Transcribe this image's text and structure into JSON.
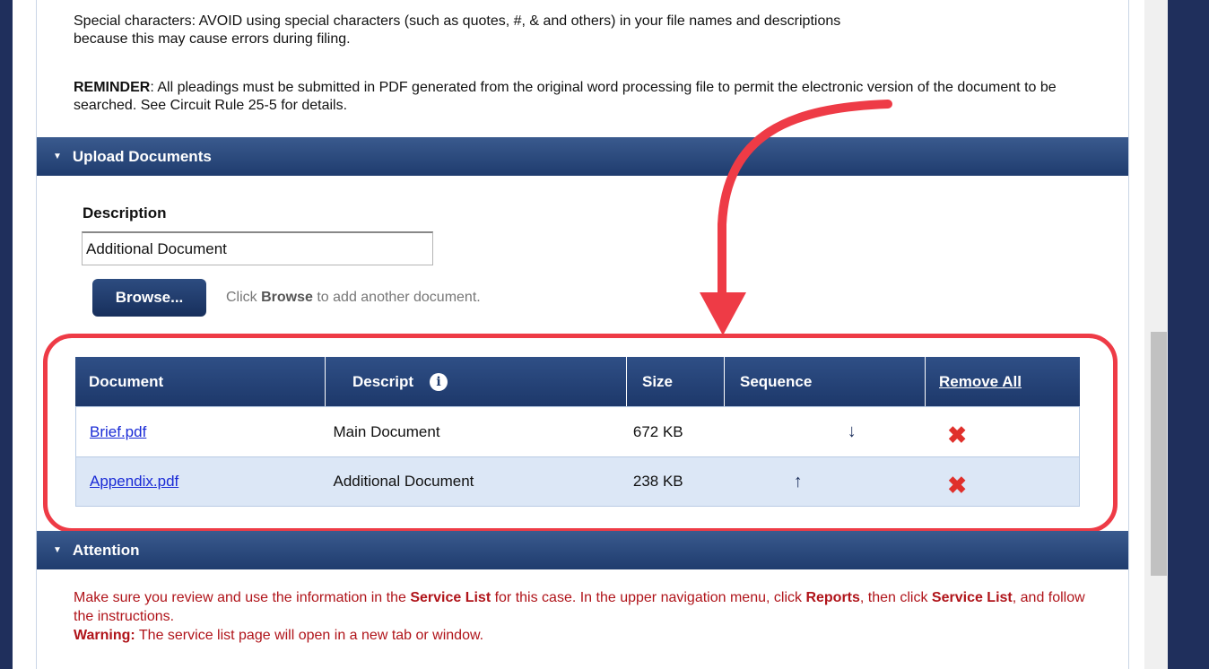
{
  "intro": {
    "special_chars_line1": "Special characters: AVOID using special characters (such as quotes, #, & and others) in your file names and descriptions",
    "special_chars_line2": "because this may cause errors during filing.",
    "reminder_label": "REMINDER",
    "reminder_text": ": All pleadings must be submitted in PDF generated from the original word processing file to permit the electronic version of the document to be searched. See Circuit Rule 25-5 for details."
  },
  "upload_section": {
    "title": "Upload Documents",
    "description_label": "Description",
    "description_value": "Additional Document",
    "browse_label": "Browse...",
    "hint_prefix": "Click ",
    "hint_bold": "Browse",
    "hint_suffix": " to add another document."
  },
  "table": {
    "headers": {
      "document": "Document",
      "description": "Descript",
      "size": "Size",
      "sequence": "Sequence",
      "remove_all": "Remove All"
    },
    "rows": [
      {
        "document": "Brief.pdf",
        "description": "Main Document",
        "size": "672 KB",
        "sequence": "down"
      },
      {
        "document": "Appendix.pdf",
        "description": "Additional Document",
        "size": "238 KB",
        "sequence": "up"
      }
    ]
  },
  "attention_section": {
    "title": "Attention",
    "line1_a": "Make sure you review and use the information in the ",
    "line1_b": "Service List",
    "line1_c": " for this case. In the upper navigation menu, click ",
    "line1_d": "Reports",
    "line1_e": ", then click ",
    "line1_f": "Service List",
    "line1_g": ", and follow the instructions.",
    "warning_label": "Warning:",
    "warning_text": " The service list page will open in a new tab or window."
  },
  "colors": {
    "header_blue": "#1f3c6e",
    "callout_red": "#ee3b46",
    "link_blue": "#1a2bd6",
    "attention_red": "#b0141a",
    "remove_red": "#e0302b"
  },
  "icons": {
    "info": "info-icon",
    "caret": "caret-down-icon",
    "arrow_up": "arrow-up-icon",
    "arrow_down": "arrow-down-icon",
    "remove": "remove-x-icon"
  }
}
